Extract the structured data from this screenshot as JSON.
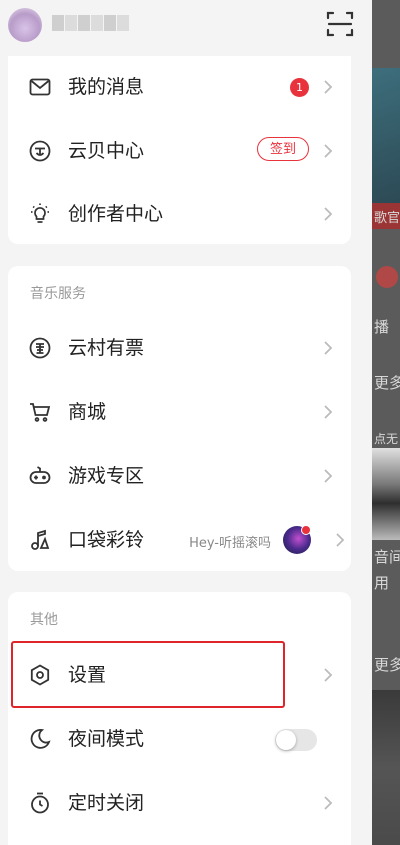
{
  "drawer": {
    "scan_icon": "scan-icon",
    "group1": [
      {
        "label": "我的消息",
        "icon": "mail-icon",
        "badge": "1"
      },
      {
        "label": "云贝中心",
        "icon": "yunbei-icon",
        "pill": "签到"
      },
      {
        "label": "创作者中心",
        "icon": "bulb-icon"
      }
    ],
    "music_section_title": "音乐服务",
    "group2": [
      {
        "label": "云村有票",
        "icon": "ticket-icon"
      },
      {
        "label": "商城",
        "icon": "cart-icon"
      },
      {
        "label": "游戏专区",
        "icon": "gamepad-icon"
      },
      {
        "label": "口袋彩铃",
        "icon": "ringtone-icon",
        "hint": "Hey-听摇滚吗"
      }
    ],
    "other_section_title": "其他",
    "group3": [
      {
        "label": "设置",
        "icon": "settings-icon"
      },
      {
        "label": "夜间模式",
        "icon": "moon-icon",
        "toggle": false
      },
      {
        "label": "定时关闭",
        "icon": "timer-icon"
      }
    ]
  },
  "background_app": {
    "fragments": [
      "歌官",
      "播",
      "更多",
      "点无",
      "音间",
      "用",
      "更多"
    ]
  },
  "colors": {
    "accent": "#e8323c",
    "highlight_box": "#e0242c"
  }
}
